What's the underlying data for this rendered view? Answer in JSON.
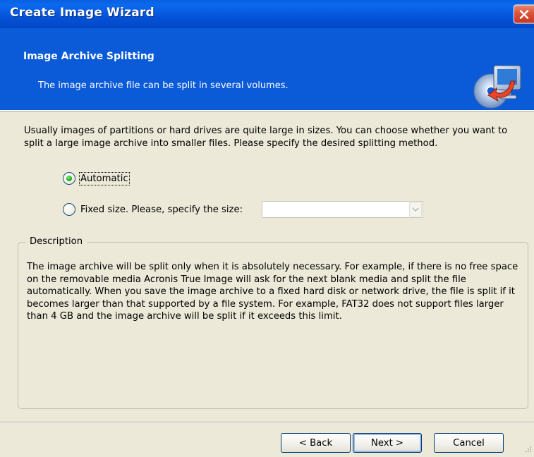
{
  "window": {
    "title": "Create Image Wizard",
    "close_label": "Close"
  },
  "header": {
    "title": "Image Archive Splitting",
    "subtitle": "The image archive file can be split in several volumes.",
    "icon": "wizard-disk-arrow-icon"
  },
  "intro": "Usually images of partitions or hard drives are quite large in sizes. You can choose whether you want to split a large image archive into smaller files. Please specify the desired splitting method.",
  "options": {
    "automatic": {
      "label": "Automatic",
      "checked": true
    },
    "fixed_size": {
      "label": "Fixed size. Please, specify the size:",
      "checked": false,
      "value": ""
    }
  },
  "description": {
    "legend": "Description",
    "text": "The image archive will be split only when it is absolutely necessary. For example, if there is no free space on the removable media Acronis True Image will ask for the next blank media and split the file automatically. When you save the image archive to a fixed hard disk or network drive, the file is split if it becomes larger than that supported by a file system. For example, FAT32 does not support files larger than 4 GB and the image archive will be split if it exceeds this limit."
  },
  "buttons": {
    "back": "< Back",
    "next": "Next >",
    "cancel": "Cancel"
  },
  "colors": {
    "titlebar": "#0453d8",
    "header": "#0b5bd9",
    "dialog_bg": "#ece9d8",
    "close": "#d9533a",
    "radio_checked": "#21b021"
  }
}
